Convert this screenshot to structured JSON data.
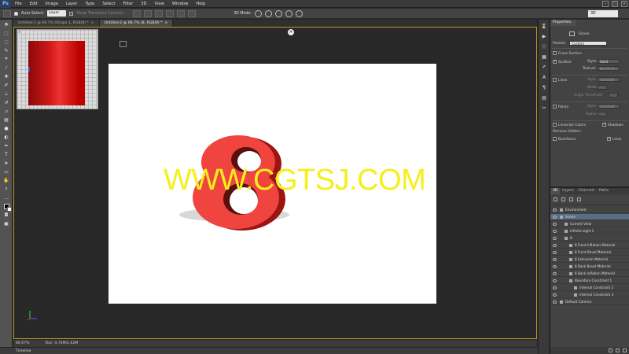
{
  "menubar": {
    "logo": "Ps",
    "items": [
      "File",
      "Edit",
      "Image",
      "Layer",
      "Type",
      "Select",
      "Filter",
      "3D",
      "View",
      "Window",
      "Help"
    ]
  },
  "options": {
    "auto_select_label": "Auto-Select:",
    "auto_select_value": "Layer",
    "transform_controls_label": "Show Transform Controls",
    "mode_3d_label": "3D Mode:",
    "workspace": "3D"
  },
  "tabs": [
    {
      "label": "Untitled-1 @ 66.7% (Shape 1, RGB/8) *",
      "active": false
    },
    {
      "label": "Untitled-2 @ 66.7% (8, RGB/8) *",
      "active": true
    }
  ],
  "canvas": {
    "close_glyph": "×",
    "watermark": "WWW.CGTSJ.COM",
    "digit": "8",
    "digit_color": "#f0443f",
    "uv_close": "×"
  },
  "status": {
    "zoom": "66.67%",
    "doc": "Doc: 4.74M/2.62M",
    "timeline": "Timeline"
  },
  "properties": {
    "tab": "Properties",
    "type_label": "Scene",
    "presets_label": "Presets:",
    "presets_value": "Custom",
    "cross_section": "Cross Section",
    "surface": "Surface",
    "style_label": "Style:",
    "surface_style": "Solid",
    "texture_label": "Texture:",
    "texture_value": "Not Avail...",
    "lines": "Lines",
    "lines_style": "Constant",
    "width_label": "Width:",
    "angle_label": "Angle Threshold:",
    "points": "Points",
    "points_style": "Constant",
    "radius_label": "Radius:",
    "linearize": "Linearize Colors",
    "shadows": "Shadows",
    "remove_hidden": "Remove Hidden:",
    "backfaces": "Backfaces",
    "lines_cb": "Lines"
  },
  "layers": {
    "tabs": [
      "3D",
      "Layers",
      "Channels",
      "Paths"
    ],
    "rows": [
      {
        "label": "Environment",
        "indent": 0,
        "selected": false
      },
      {
        "label": "Scene",
        "indent": 0,
        "selected": true
      },
      {
        "label": "Current View",
        "indent": 1,
        "selected": false
      },
      {
        "label": "Infinite Light 1",
        "indent": 1,
        "selected": false
      },
      {
        "label": "8",
        "indent": 1,
        "selected": false
      },
      {
        "label": "8 Front Inflation Material",
        "indent": 2,
        "selected": false
      },
      {
        "label": "8 Front Bevel Material",
        "indent": 2,
        "selected": false
      },
      {
        "label": "8 Extrusion Material",
        "indent": 2,
        "selected": false
      },
      {
        "label": "8 Back Bevel Material",
        "indent": 2,
        "selected": false
      },
      {
        "label": "8 Back Inflation Material",
        "indent": 2,
        "selected": false
      },
      {
        "label": "Boundary Constraint 1",
        "indent": 2,
        "selected": false
      },
      {
        "label": "Internal Constraint 2",
        "indent": 3,
        "selected": false
      },
      {
        "label": "Internal Constraint 3",
        "indent": 3,
        "selected": false
      },
      {
        "label": "Default Camera",
        "indent": 0,
        "selected": false
      }
    ]
  },
  "colors": {
    "accent_border": "#b89b1d",
    "watermark": "#f5ef1d",
    "selection": "#5a6d86"
  }
}
